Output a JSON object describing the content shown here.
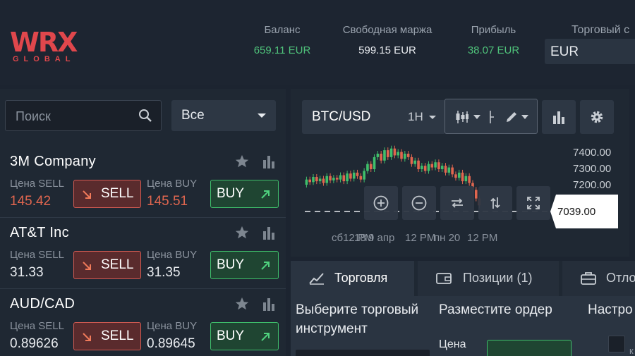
{
  "header": {
    "logo_main": "WRX",
    "logo_sub": "GLOBAL",
    "balance": {
      "label": "Баланс",
      "value": "659.11 EUR"
    },
    "free_margin": {
      "label": "Свободная маржа",
      "value": "599.15 EUR"
    },
    "profit": {
      "label": "Прибыль",
      "value": "38.07 EUR"
    },
    "trading_currency": {
      "label": "Торговый с",
      "value": "EUR"
    }
  },
  "sidebar": {
    "search_placeholder": "Поиск",
    "filter_value": "Все",
    "instruments": [
      {
        "name": "3M Company",
        "sell_label": "Цена SELL",
        "sell_price": "145.42",
        "buy_label": "Цена BUY",
        "buy_price": "145.51",
        "sell_btn": "SELL",
        "buy_btn": "BUY"
      },
      {
        "name": "AT&T Inc",
        "sell_label": "Цена SELL",
        "sell_price": "31.33",
        "buy_label": "Цена BUY",
        "buy_price": "31.35",
        "sell_btn": "SELL",
        "buy_btn": "BUY"
      },
      {
        "name": "AUD/CAD",
        "sell_label": "Цена SELL",
        "sell_price": "0.89626",
        "buy_label": "Цена BUY",
        "buy_price": "0.89645",
        "sell_btn": "SELL",
        "buy_btn": "BUY"
      }
    ]
  },
  "chart": {
    "symbol": "BTC/USD",
    "symbol_more": "1(",
    "timeframe": "1H",
    "y_ticks": [
      "7400.00",
      "7300.00",
      "7200.00"
    ],
    "x_ticks": [
      "сб12 PM",
      "18",
      "9 апр",
      "12 PM",
      "пн 20",
      "12 PM"
    ],
    "current_price": "7039.00",
    "colors": {
      "up": "#3fbf6b",
      "down": "#e0664f"
    }
  },
  "bottom": {
    "tabs": [
      {
        "label": "Торговля"
      },
      {
        "label": "Позиции (1)"
      },
      {
        "label": "Отло"
      }
    ],
    "col1_title": "Выберите торговый инструмент",
    "col2_title": "Разместите ордер",
    "col3_title": "Настро",
    "price_label": "Цена",
    "checkbox_label": "к"
  },
  "chart_data": {
    "type": "candlestick",
    "ylim": [
      7000,
      7450
    ],
    "candles": [
      [
        7180,
        7210
      ],
      [
        7210,
        7195
      ],
      [
        7195,
        7225
      ],
      [
        7225,
        7200
      ],
      [
        7200,
        7215
      ],
      [
        7215,
        7190
      ],
      [
        7190,
        7230
      ],
      [
        7230,
        7205
      ],
      [
        7205,
        7220
      ],
      [
        7220,
        7210
      ],
      [
        7210,
        7235
      ],
      [
        7235,
        7200
      ],
      [
        7200,
        7245
      ],
      [
        7245,
        7215
      ],
      [
        7215,
        7250
      ],
      [
        7250,
        7230
      ],
      [
        7230,
        7210
      ],
      [
        7210,
        7260
      ],
      [
        7260,
        7300
      ],
      [
        7300,
        7270
      ],
      [
        7270,
        7340
      ],
      [
        7340,
        7360
      ],
      [
        7360,
        7320
      ],
      [
        7320,
        7380
      ],
      [
        7380,
        7340
      ],
      [
        7340,
        7390
      ],
      [
        7390,
        7350
      ],
      [
        7350,
        7370
      ],
      [
        7370,
        7330
      ],
      [
        7330,
        7360
      ],
      [
        7360,
        7340
      ],
      [
        7340,
        7300
      ],
      [
        7300,
        7320
      ],
      [
        7320,
        7270
      ],
      [
        7270,
        7290
      ],
      [
        7290,
        7260
      ],
      [
        7260,
        7300
      ],
      [
        7300,
        7280
      ],
      [
        7280,
        7310
      ],
      [
        7310,
        7270
      ],
      [
        7270,
        7290
      ],
      [
        7290,
        7250
      ],
      [
        7250,
        7280
      ],
      [
        7280,
        7240
      ],
      [
        7240,
        7220
      ],
      [
        7220,
        7250
      ],
      [
        7250,
        7200
      ],
      [
        7200,
        7230
      ],
      [
        7230,
        7190
      ],
      [
        7190,
        7150
      ],
      [
        7150,
        7100
      ],
      [
        7100,
        7060
      ]
    ]
  }
}
